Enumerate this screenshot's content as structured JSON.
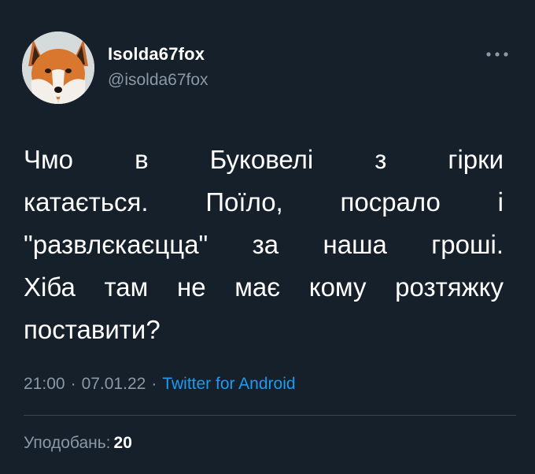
{
  "author": {
    "display_name": "Isolda67fox",
    "handle": "@isolda67fox",
    "avatar_icon": "fox-avatar"
  },
  "more_icon": "ellipsis-icon",
  "tweet": {
    "lines": [
      "Чмо в Буковелі з гірки",
      "катається. Поїло, посрало і",
      "\"развлєкаєцца\" за наша гроші.",
      "Хіба там не має кому розтяжку",
      "поставити?"
    ]
  },
  "meta": {
    "time": "21:00",
    "separator": "·",
    "date": "07.01.22",
    "source": "Twitter for Android"
  },
  "likes": {
    "label": "Уподобань:",
    "count": "20"
  },
  "colors": {
    "background": "#15202b",
    "text": "#ffffff",
    "secondary": "#8b98a5",
    "link": "#1d9bf0",
    "divider": "#38444d"
  }
}
